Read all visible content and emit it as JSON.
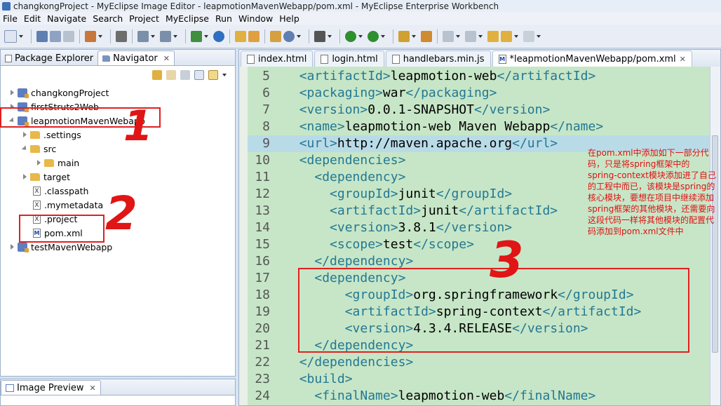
{
  "window": {
    "title": "changkongProject - MyEclipse Image Editor - leapmotionMavenWebapp/pom.xml - MyEclipse Enterprise Workbench"
  },
  "menu": [
    "File",
    "Edit",
    "Navigate",
    "Search",
    "Project",
    "MyEclipse",
    "Run",
    "Window",
    "Help"
  ],
  "left_panel": {
    "tabs": [
      {
        "label": "Package Explorer"
      },
      {
        "label": "Navigator",
        "close": "✕"
      }
    ],
    "tree": [
      {
        "label": "changkongProject",
        "icon": "project-icon"
      },
      {
        "label": "firstStruts2Web",
        "icon": "project-icon"
      },
      {
        "label": "leapmotionMavenWebapp",
        "icon": "project-icon"
      },
      {
        "label": ".settings",
        "icon": "folder-icon"
      },
      {
        "label": "src",
        "icon": "folder-icon"
      },
      {
        "label": "main",
        "icon": "folder-icon"
      },
      {
        "label": "target",
        "icon": "folder-icon"
      },
      {
        "label": ".classpath",
        "icon": "xml-file-icon"
      },
      {
        "label": ".mymetadata",
        "icon": "xml-file-icon"
      },
      {
        "label": ".project",
        "icon": "xml-file-icon"
      },
      {
        "label": "pom.xml",
        "icon": "maven-file-icon"
      },
      {
        "label": "testMavenWebapp",
        "icon": "project-icon"
      }
    ]
  },
  "preview_panel": {
    "tab": "Image Preview",
    "close": "✕"
  },
  "editor": {
    "tabs": [
      {
        "label": "index.html"
      },
      {
        "label": "login.html"
      },
      {
        "label": "handlebars.min.js"
      },
      {
        "label": "*leapmotionMavenWebapp/pom.xml",
        "close": "✕"
      }
    ],
    "lines": [
      {
        "n": "5",
        "indent": "  ",
        "open": "<artifactId>",
        "text": "leapmotion-web",
        "close": "</artifactId>"
      },
      {
        "n": "6",
        "indent": "  ",
        "open": "<packaging>",
        "text": "war",
        "close": "</packaging>"
      },
      {
        "n": "7",
        "indent": "  ",
        "open": "<version>",
        "text": "0.0.1-SNAPSHOT",
        "close": "</version>"
      },
      {
        "n": "8",
        "indent": "  ",
        "open": "<name>",
        "text": "leapmotion-web Maven Webapp",
        "close": "</name>"
      },
      {
        "n": "9",
        "indent": "  ",
        "open": "<url>",
        "text": "http://maven.apache.org",
        "close": "</url>"
      },
      {
        "n": "10",
        "indent": "  ",
        "open": "<dependencies>",
        "text": "",
        "close": ""
      },
      {
        "n": "11",
        "indent": "    ",
        "open": "<dependency>",
        "text": "",
        "close": ""
      },
      {
        "n": "12",
        "indent": "      ",
        "open": "<groupId>",
        "text": "junit",
        "close": "</groupId>"
      },
      {
        "n": "13",
        "indent": "      ",
        "open": "<artifactId>",
        "text": "junit",
        "close": "</artifactId>"
      },
      {
        "n": "14",
        "indent": "      ",
        "open": "<version>",
        "text": "3.8.1",
        "close": "</version>"
      },
      {
        "n": "15",
        "indent": "      ",
        "open": "<scope>",
        "text": "test",
        "close": "</scope>"
      },
      {
        "n": "16",
        "indent": "    ",
        "open": "</dependency>",
        "text": "",
        "close": ""
      },
      {
        "n": "17",
        "indent": "    ",
        "open": "<dependency>",
        "text": "",
        "close": ""
      },
      {
        "n": "18",
        "indent": "        ",
        "open": "<groupId>",
        "text": "org.springframework",
        "close": "</groupId>"
      },
      {
        "n": "19",
        "indent": "        ",
        "open": "<artifactId>",
        "text": "spring-context",
        "close": "</artifactId>"
      },
      {
        "n": "20",
        "indent": "        ",
        "open": "<version>",
        "text": "4.3.4.RELEASE",
        "close": "</version>"
      },
      {
        "n": "21",
        "indent": "    ",
        "open": "</dependency>",
        "text": "",
        "close": ""
      },
      {
        "n": "22",
        "indent": "  ",
        "open": "</dependencies>",
        "text": "",
        "close": ""
      },
      {
        "n": "23",
        "indent": "  ",
        "open": "<build>",
        "text": "",
        "close": ""
      },
      {
        "n": "24",
        "indent": "    ",
        "open": "<finalName>",
        "text": "leapmotion-web",
        "close": "</finalName>"
      }
    ]
  },
  "annotation": {
    "note": "在pom.xml中添加如下一部分代码，只是将spring框架中的spring-context模块添加进了自己的工程中而已，该模块是spring的核心模块，要想在项目中继续添加spring框架的其他模块，还需要向这段代码一样将其他模块的配置代码添加到pom.xml文件中",
    "marks": [
      "1",
      "2",
      "3"
    ],
    "color": "#e01010"
  }
}
